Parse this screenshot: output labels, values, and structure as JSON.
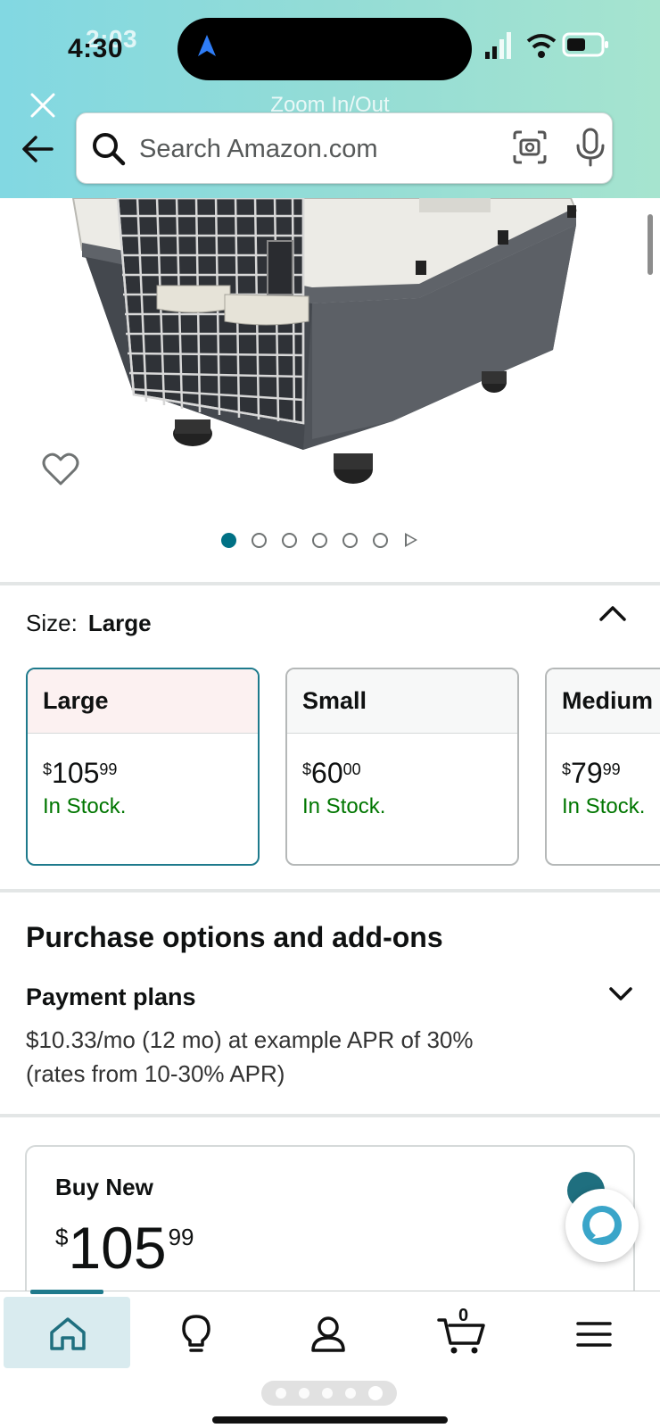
{
  "status_bar": {
    "time": "4:30",
    "time_ghost": "2:03"
  },
  "header": {
    "zoom_overlay": "Zoom In/Out",
    "search": {
      "placeholder": "Search Amazon.com"
    },
    "icons": [
      "close-icon",
      "back-arrow-icon",
      "search-icon",
      "camera-icon",
      "mic-icon"
    ]
  },
  "product": {
    "image_dots": 6,
    "active_image": 1
  },
  "size": {
    "label": "Size:",
    "selected": "Large",
    "options": [
      {
        "name": "Large",
        "price_symbol": "$",
        "price_whole": "105",
        "price_cents": "99",
        "stock": "In Stock."
      },
      {
        "name": "Small",
        "price_symbol": "$",
        "price_whole": "60",
        "price_cents": "00",
        "stock": "In Stock."
      },
      {
        "name": "Medium",
        "price_symbol": "$",
        "price_whole": "79",
        "price_cents": "99",
        "stock": "In Stock."
      }
    ]
  },
  "purchase_options": {
    "title": "Purchase options and add-ons",
    "payment_plans_title": "Payment plans",
    "payment_plans_text": "$10.33/mo (12 mo) at example APR of 30% (rates from 10-30% APR)"
  },
  "buy_new": {
    "title": "Buy New",
    "price_symbol": "$",
    "price_whole": "105",
    "price_cents": "99"
  },
  "bottom_nav": {
    "cart_count": "0",
    "items": [
      "home-icon",
      "lightbulb-icon",
      "account-icon",
      "cart-icon",
      "menu-icon"
    ]
  },
  "colors": {
    "header_gradient_start": "#82d8e2",
    "header_gradient_end": "#a6e4cf",
    "in_stock": "#007600",
    "accent_teal": "#007185"
  }
}
